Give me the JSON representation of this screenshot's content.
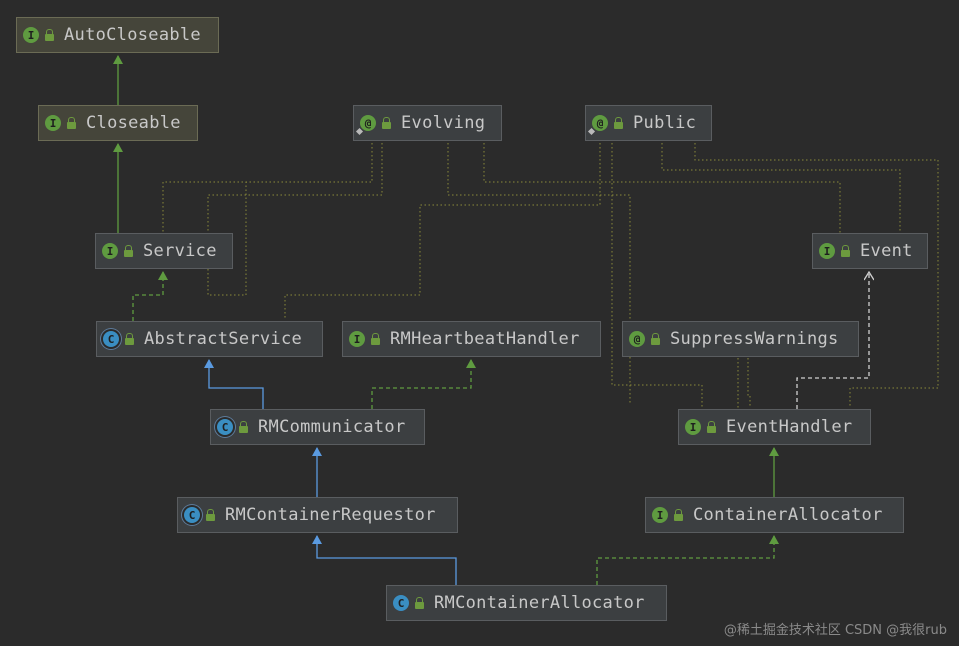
{
  "nodes": [
    {
      "id": "AutoCloseable",
      "label": "AutoCloseable",
      "kind": "interface",
      "badge": "I"
    },
    {
      "id": "Closeable",
      "label": "Closeable",
      "kind": "interface",
      "badge": "I"
    },
    {
      "id": "Evolving",
      "label": "Evolving",
      "kind": "annotation",
      "badge": "@"
    },
    {
      "id": "Public",
      "label": "Public",
      "kind": "annotation",
      "badge": "@"
    },
    {
      "id": "Service",
      "label": "Service",
      "kind": "interface",
      "badge": "I"
    },
    {
      "id": "Event",
      "label": "Event",
      "kind": "interface",
      "badge": "I"
    },
    {
      "id": "AbstractService",
      "label": "AbstractService",
      "kind": "abstract",
      "badge": "C"
    },
    {
      "id": "RMHeartbeatHandler",
      "label": "RMHeartbeatHandler",
      "kind": "interface",
      "badge": "I"
    },
    {
      "id": "SuppressWarnings",
      "label": "SuppressWarnings",
      "kind": "annotation",
      "badge": "@"
    },
    {
      "id": "RMCommunicator",
      "label": "RMCommunicator",
      "kind": "abstract",
      "badge": "C"
    },
    {
      "id": "EventHandler",
      "label": "EventHandler",
      "kind": "interface",
      "badge": "I"
    },
    {
      "id": "RMContainerRequestor",
      "label": "RMContainerRequestor",
      "kind": "abstract",
      "badge": "C"
    },
    {
      "id": "ContainerAllocator",
      "label": "ContainerAllocator",
      "kind": "interface",
      "badge": "I"
    },
    {
      "id": "RMContainerAllocator",
      "label": "RMContainerAllocator",
      "kind": "class",
      "badge": "C"
    }
  ],
  "colors": {
    "extends": "#5f9b40",
    "implements_class": "#5a9ae0",
    "implements_iface": "#5f9b40",
    "realizes_white": "#d0d0d0",
    "annotation_link": "#8a8a3a"
  },
  "watermark": "@稀土掘金技术社区 CSDN @我很rub"
}
